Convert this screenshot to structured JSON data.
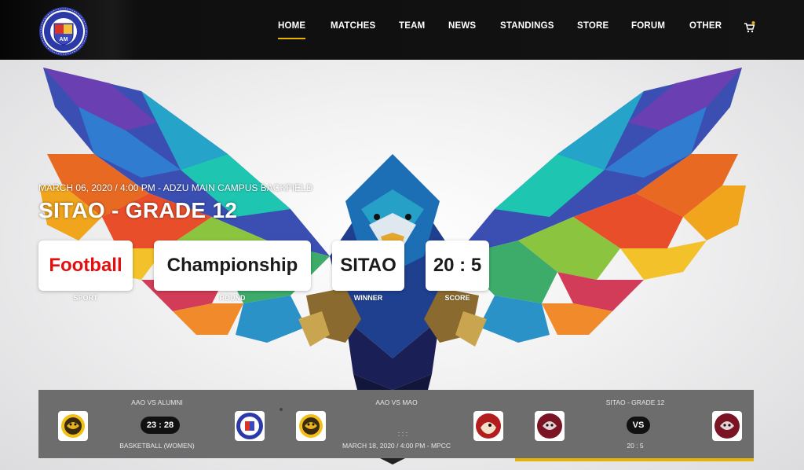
{
  "nav": {
    "items": [
      {
        "label": "HOME",
        "active": true
      },
      {
        "label": "MATCHES",
        "active": false
      },
      {
        "label": "TEAM",
        "active": false
      },
      {
        "label": "NEWS",
        "active": false
      },
      {
        "label": "STANDINGS",
        "active": false
      },
      {
        "label": "STORE",
        "active": false
      },
      {
        "label": "FORUM",
        "active": false
      },
      {
        "label": "OTHER",
        "active": false
      }
    ],
    "cart_icon": "cart-icon",
    "accent_color": "#e8b200"
  },
  "hero": {
    "meta": "MARCH 06, 2020 / 4:00 PM - ADZU MAIN CAMPUS BACKFIELD",
    "title": "SITAO - GRADE 12",
    "stats": {
      "sport": {
        "value": "Football",
        "label": "SPORT"
      },
      "round": {
        "value": "Championship",
        "label": "ROUND"
      },
      "winner": {
        "value": "SITAO",
        "label": "WINNER"
      },
      "score": {
        "value": "20 : 5",
        "label": "SCORE"
      }
    },
    "sport_color": "#e20f0f"
  },
  "carousel": {
    "slides": [
      {
        "title": "AAO VS ALUMNI",
        "score": "23 : 28",
        "sub": "BASKETBALL (WOMEN)",
        "home_logo": "tiger-logo",
        "away_logo": "university-seal-logo"
      },
      {
        "title": "AAO VS MAO",
        "score": ":        :        :",
        "sub": "MARCH 18, 2020 / 4:00 PM - MPCC",
        "home_logo": "tiger-logo",
        "away_logo": "red-eagle-logo"
      },
      {
        "title": "SITAO - GRADE 12",
        "score": "VS",
        "sub": "20 : 5",
        "home_logo": "maroon-beast-logo",
        "away_logo": "maroon-beast-logo"
      }
    ]
  }
}
